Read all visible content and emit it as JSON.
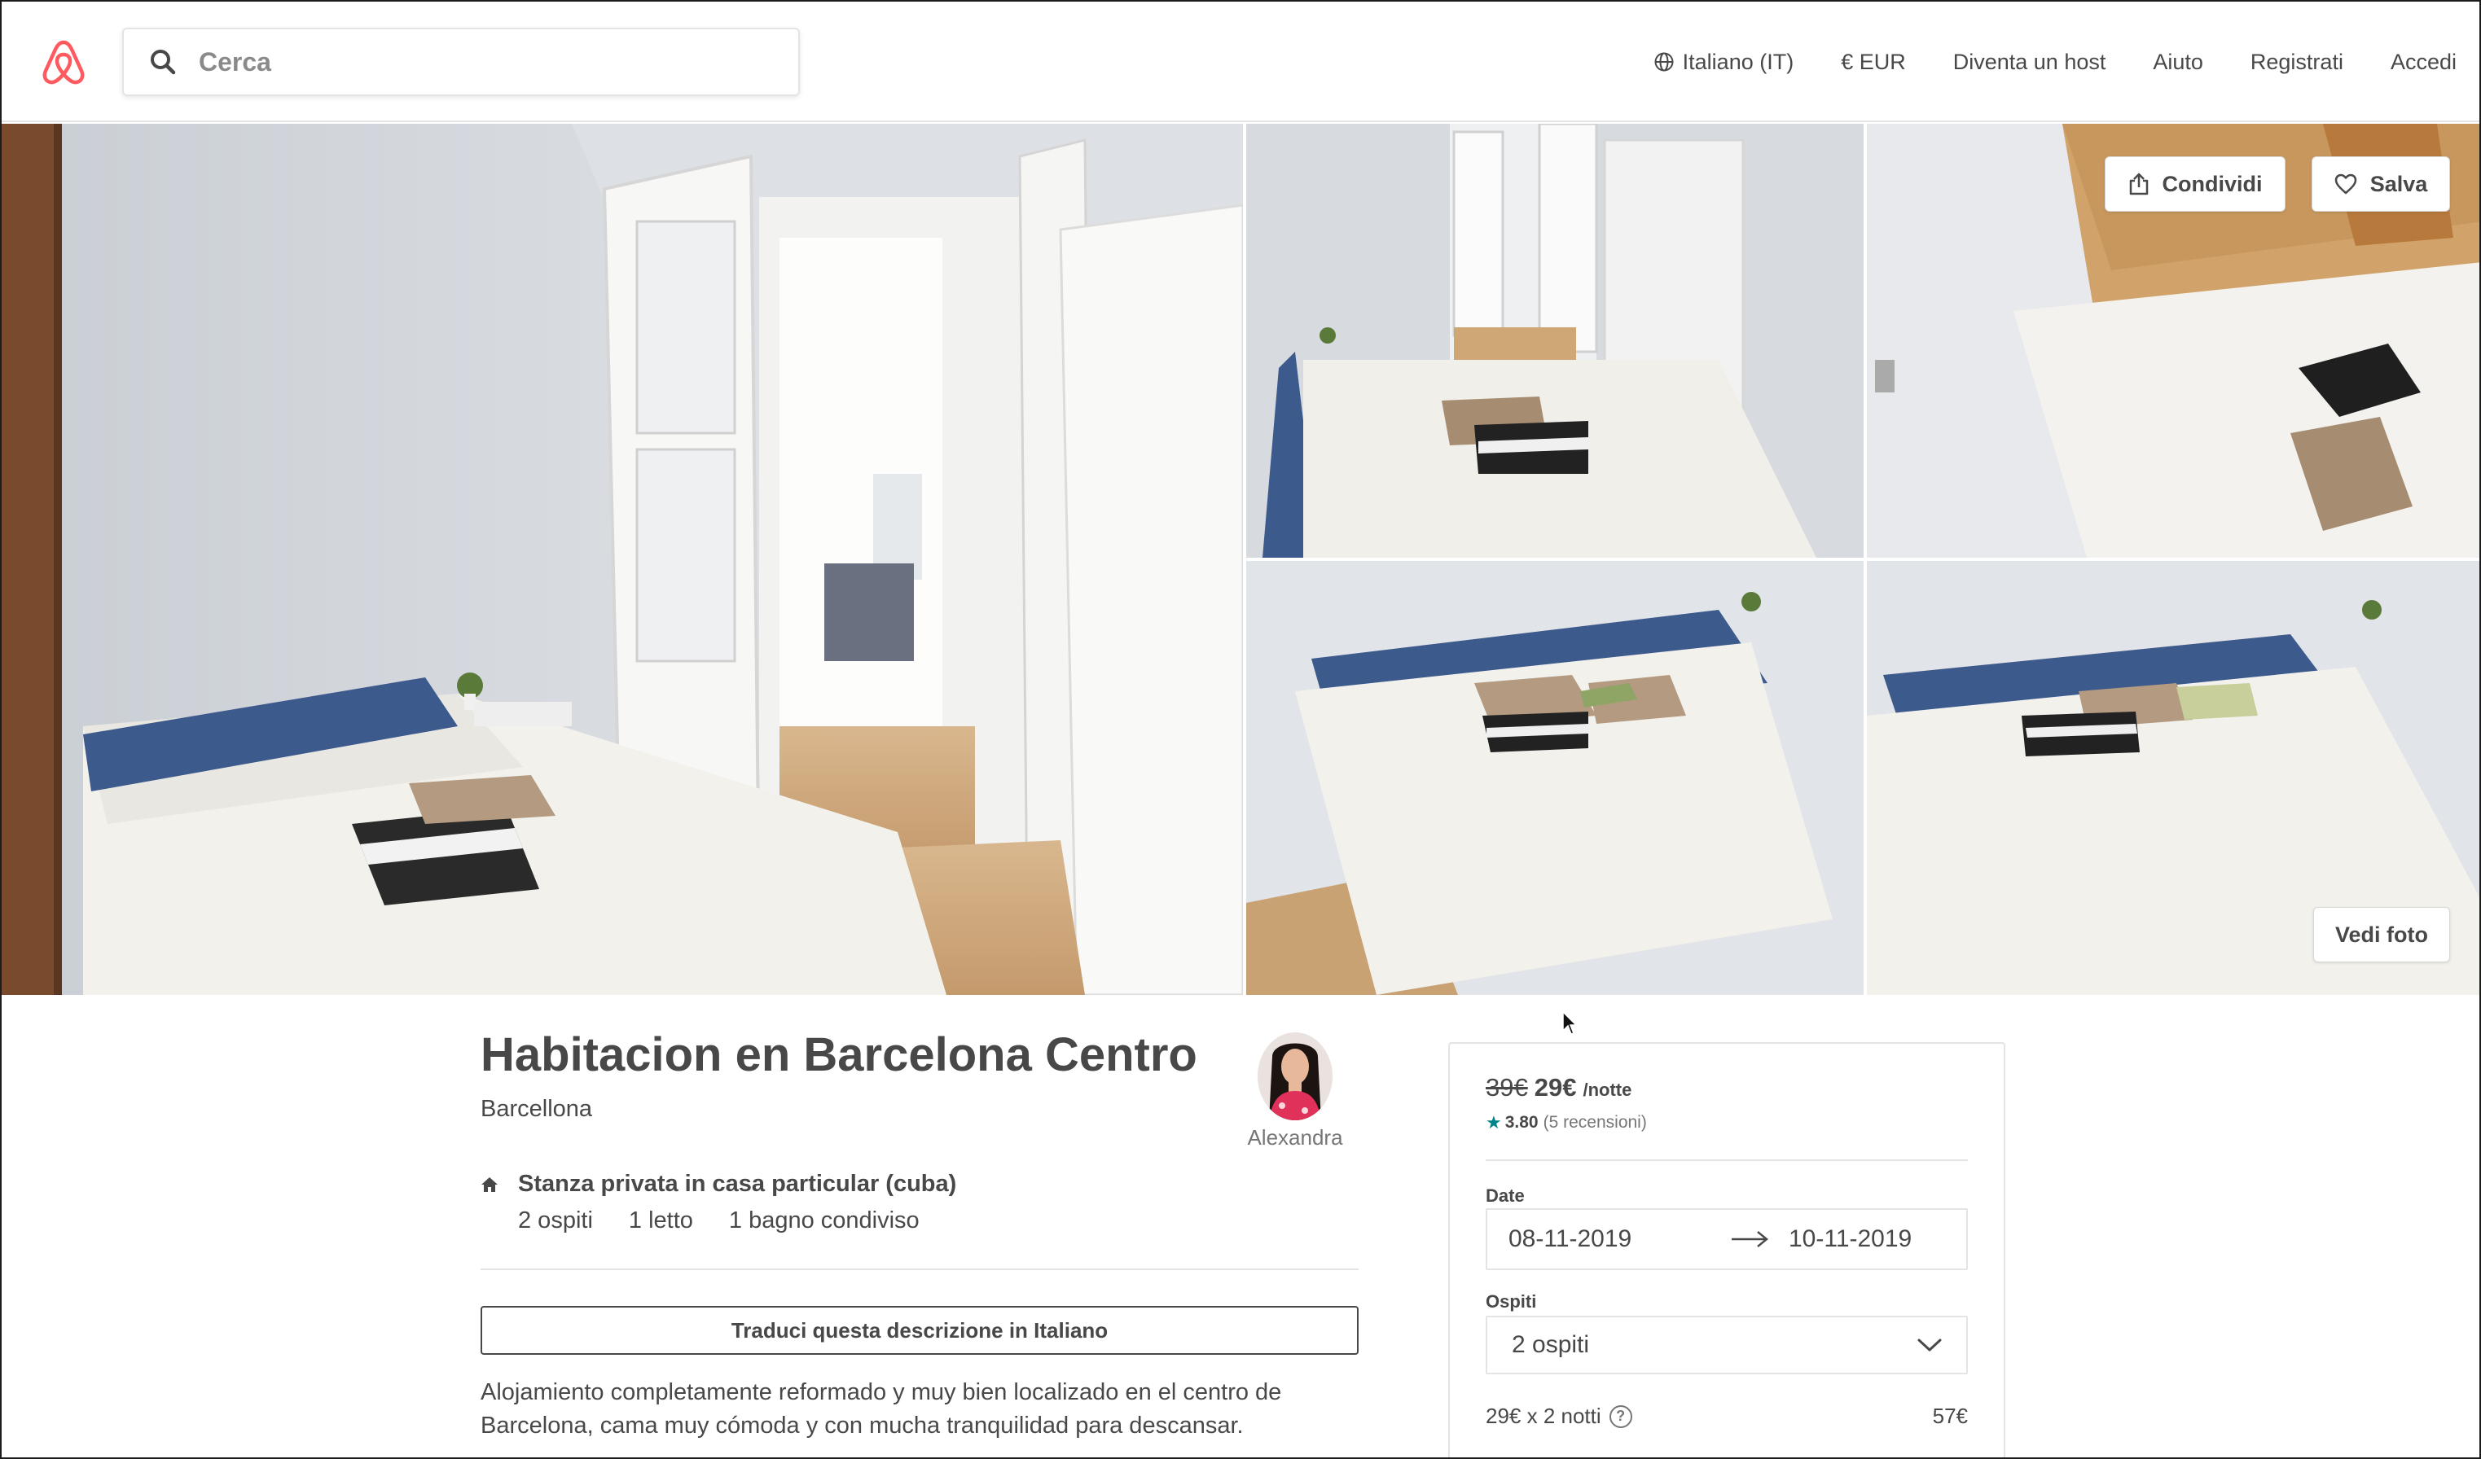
{
  "header": {
    "search_placeholder": "Cerca",
    "nav": {
      "language": "Italiano (IT)",
      "currency": "€ EUR",
      "become_host": "Diventa un host",
      "help": "Aiuto",
      "signup": "Registrati",
      "login": "Accedi"
    }
  },
  "gallery": {
    "share_label": "Condividi",
    "save_label": "Salva",
    "view_photos_label": "Vedi foto"
  },
  "listing": {
    "title": "Habitacion en Barcelona Centro",
    "city": "Barcellona",
    "host_name": "Alexandra",
    "room_type": "Stanza privata in casa particular (cuba)",
    "details": {
      "guests": "2 ospiti",
      "beds": "1 letto",
      "bath": "1 bagno condiviso"
    },
    "translate_label": "Traduci questa descrizione in Italiano",
    "description": "Alojamiento completamente reformado y muy bien localizado en el centro de Barcelona, cama muy cómoda y con mucha tranquilidad para descansar."
  },
  "booking": {
    "old_price": "39€",
    "new_price": "29€",
    "per_night": "/notte",
    "rating_score": "3.80",
    "reviews": "(5 recensioni)",
    "dates_label": "Date",
    "checkin": "08-11-2019",
    "checkout": "10-11-2019",
    "guests_label": "Ospiti",
    "guests_value": "2 ospiti",
    "calc_label": "29€ x 2 notti",
    "calc_total": "57€"
  },
  "colors": {
    "brand": "#FF5A5F",
    "text": "#484848",
    "muted": "#767676",
    "star": "#008489",
    "border": "#e4e4e4"
  },
  "icons": [
    "airbnb-logo",
    "search-icon",
    "globe-icon",
    "share-icon",
    "heart-icon",
    "home-icon",
    "arrow-right-icon",
    "chevron-down-icon",
    "question-icon",
    "star-icon"
  ]
}
